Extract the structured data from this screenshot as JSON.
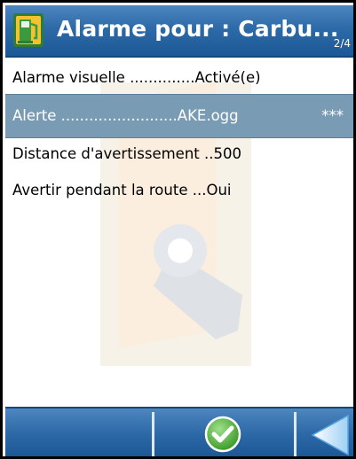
{
  "header": {
    "title": "Alarme pour : Carbu...",
    "page_indicator": "2/4",
    "icon": "fuel-pump-icon"
  },
  "settings": [
    {
      "label": "Alarme visuelle ..............Activé(e)",
      "selected": false
    },
    {
      "label": "Alerte .........................AKE.ogg",
      "suffix": "***",
      "selected": true
    },
    {
      "label": "Distance d'avertissement ..500",
      "selected": false
    },
    {
      "label": "Avertir pendant la route ...Oui",
      "selected": false
    }
  ],
  "toolbar": {
    "ok_icon": "check-circle-icon",
    "back_icon": "triangle-left-icon"
  },
  "colors": {
    "bar_blue": "#2d6aa8",
    "selected_row": "#7a9bb4"
  }
}
